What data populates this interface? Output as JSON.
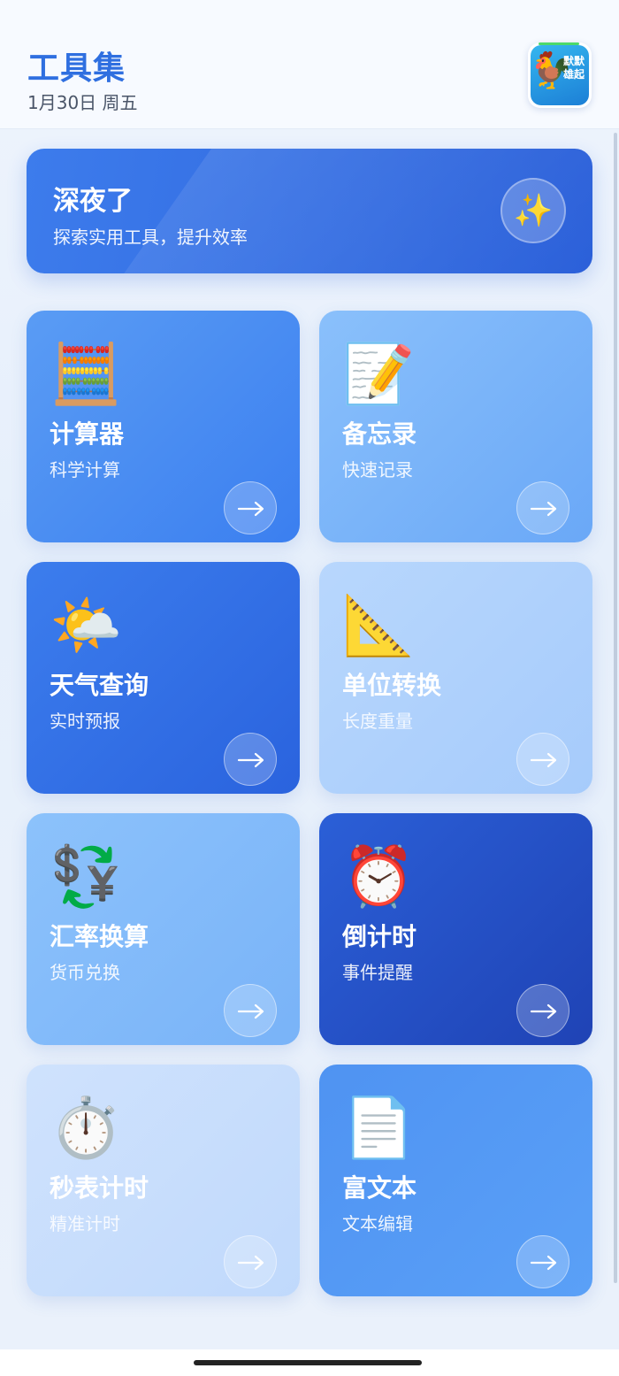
{
  "header": {
    "title": "工具集",
    "date": "1月30日 周五",
    "avatar_text": "默默雄起"
  },
  "banner": {
    "title": "深夜了",
    "subtitle": "探索实用工具，提升效率",
    "badge_icon": "sparkles-icon"
  },
  "tools": [
    {
      "title": "计算器",
      "subtitle": "科学计算",
      "icon": "abacus-icon"
    },
    {
      "title": "备忘录",
      "subtitle": "快速记录",
      "icon": "memo-icon"
    },
    {
      "title": "天气查询",
      "subtitle": "实时预报",
      "icon": "weather-icon"
    },
    {
      "title": "单位转换",
      "subtitle": "长度重量",
      "icon": "ruler-icon"
    },
    {
      "title": "汇率换算",
      "subtitle": "货币兑换",
      "icon": "currency-exchange-icon"
    },
    {
      "title": "倒计时",
      "subtitle": "事件提醒",
      "icon": "alarm-clock-icon"
    },
    {
      "title": "秒表计时",
      "subtitle": "精准计时",
      "icon": "stopwatch-icon"
    },
    {
      "title": "富文本",
      "subtitle": "文本编辑",
      "icon": "document-icon"
    }
  ]
}
